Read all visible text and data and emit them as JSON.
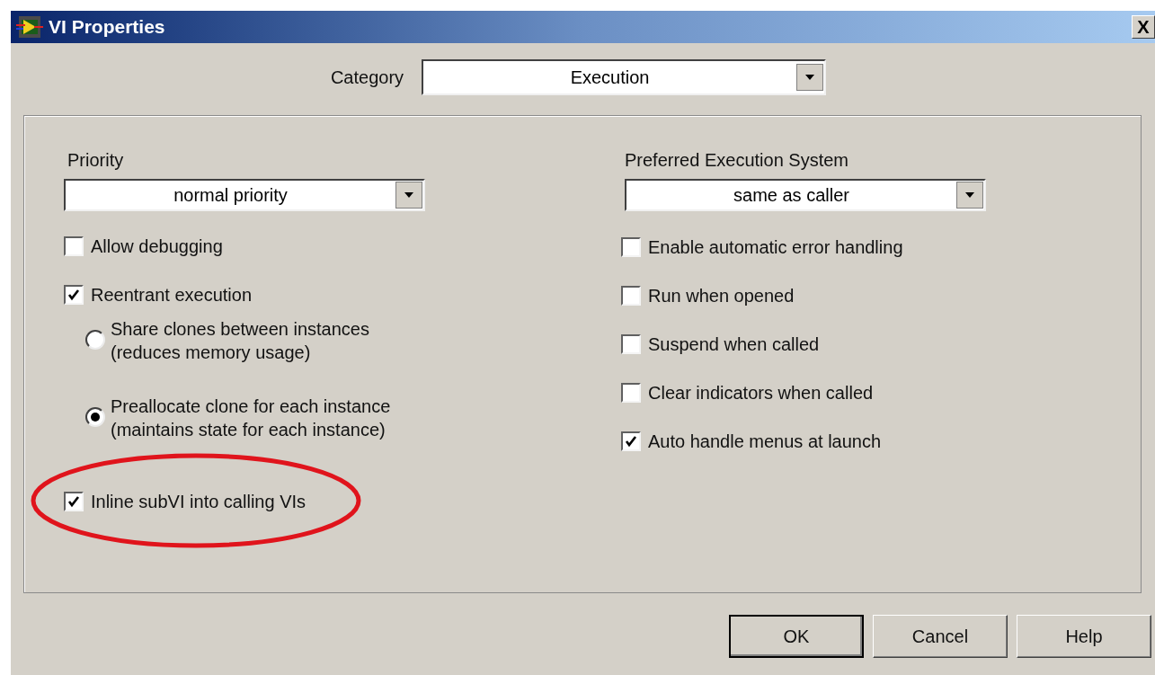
{
  "window": {
    "title": "VI Properties",
    "close": "X"
  },
  "category": {
    "label": "Category",
    "value": "Execution"
  },
  "priority": {
    "label": "Priority",
    "value": "normal priority"
  },
  "left_items": [
    {
      "kind": "checkbox",
      "label": "Allow debugging",
      "checked": false,
      "highlighted": false
    },
    {
      "kind": "checkbox",
      "label": "Reentrant execution",
      "checked": true,
      "highlighted": false
    },
    {
      "kind": "radio",
      "label": "Share clones between instances",
      "sublabel": "(reduces memory usage)",
      "selected": false
    },
    {
      "kind": "radio",
      "label": "Preallocate clone for each instance",
      "sublabel": "(maintains state for each instance)",
      "selected": true
    },
    {
      "kind": "checkbox",
      "label": "Inline subVI into calling VIs",
      "checked": true,
      "highlighted": true
    }
  ],
  "execution_system": {
    "label": "Preferred Execution System",
    "value": "same as caller"
  },
  "right_items": [
    {
      "kind": "checkbox",
      "label": "Enable automatic error handling",
      "checked": false
    },
    {
      "kind": "checkbox",
      "label": "Run when opened",
      "checked": false
    },
    {
      "kind": "checkbox",
      "label": "Suspend when called",
      "checked": false
    },
    {
      "kind": "checkbox",
      "label": "Clear indicators when called",
      "checked": false
    },
    {
      "kind": "checkbox",
      "label": "Auto handle menus at launch",
      "checked": true
    }
  ],
  "buttons": [
    {
      "label": "OK",
      "default": true
    },
    {
      "label": "Cancel",
      "default": false
    },
    {
      "label": "Help",
      "default": false
    }
  ]
}
